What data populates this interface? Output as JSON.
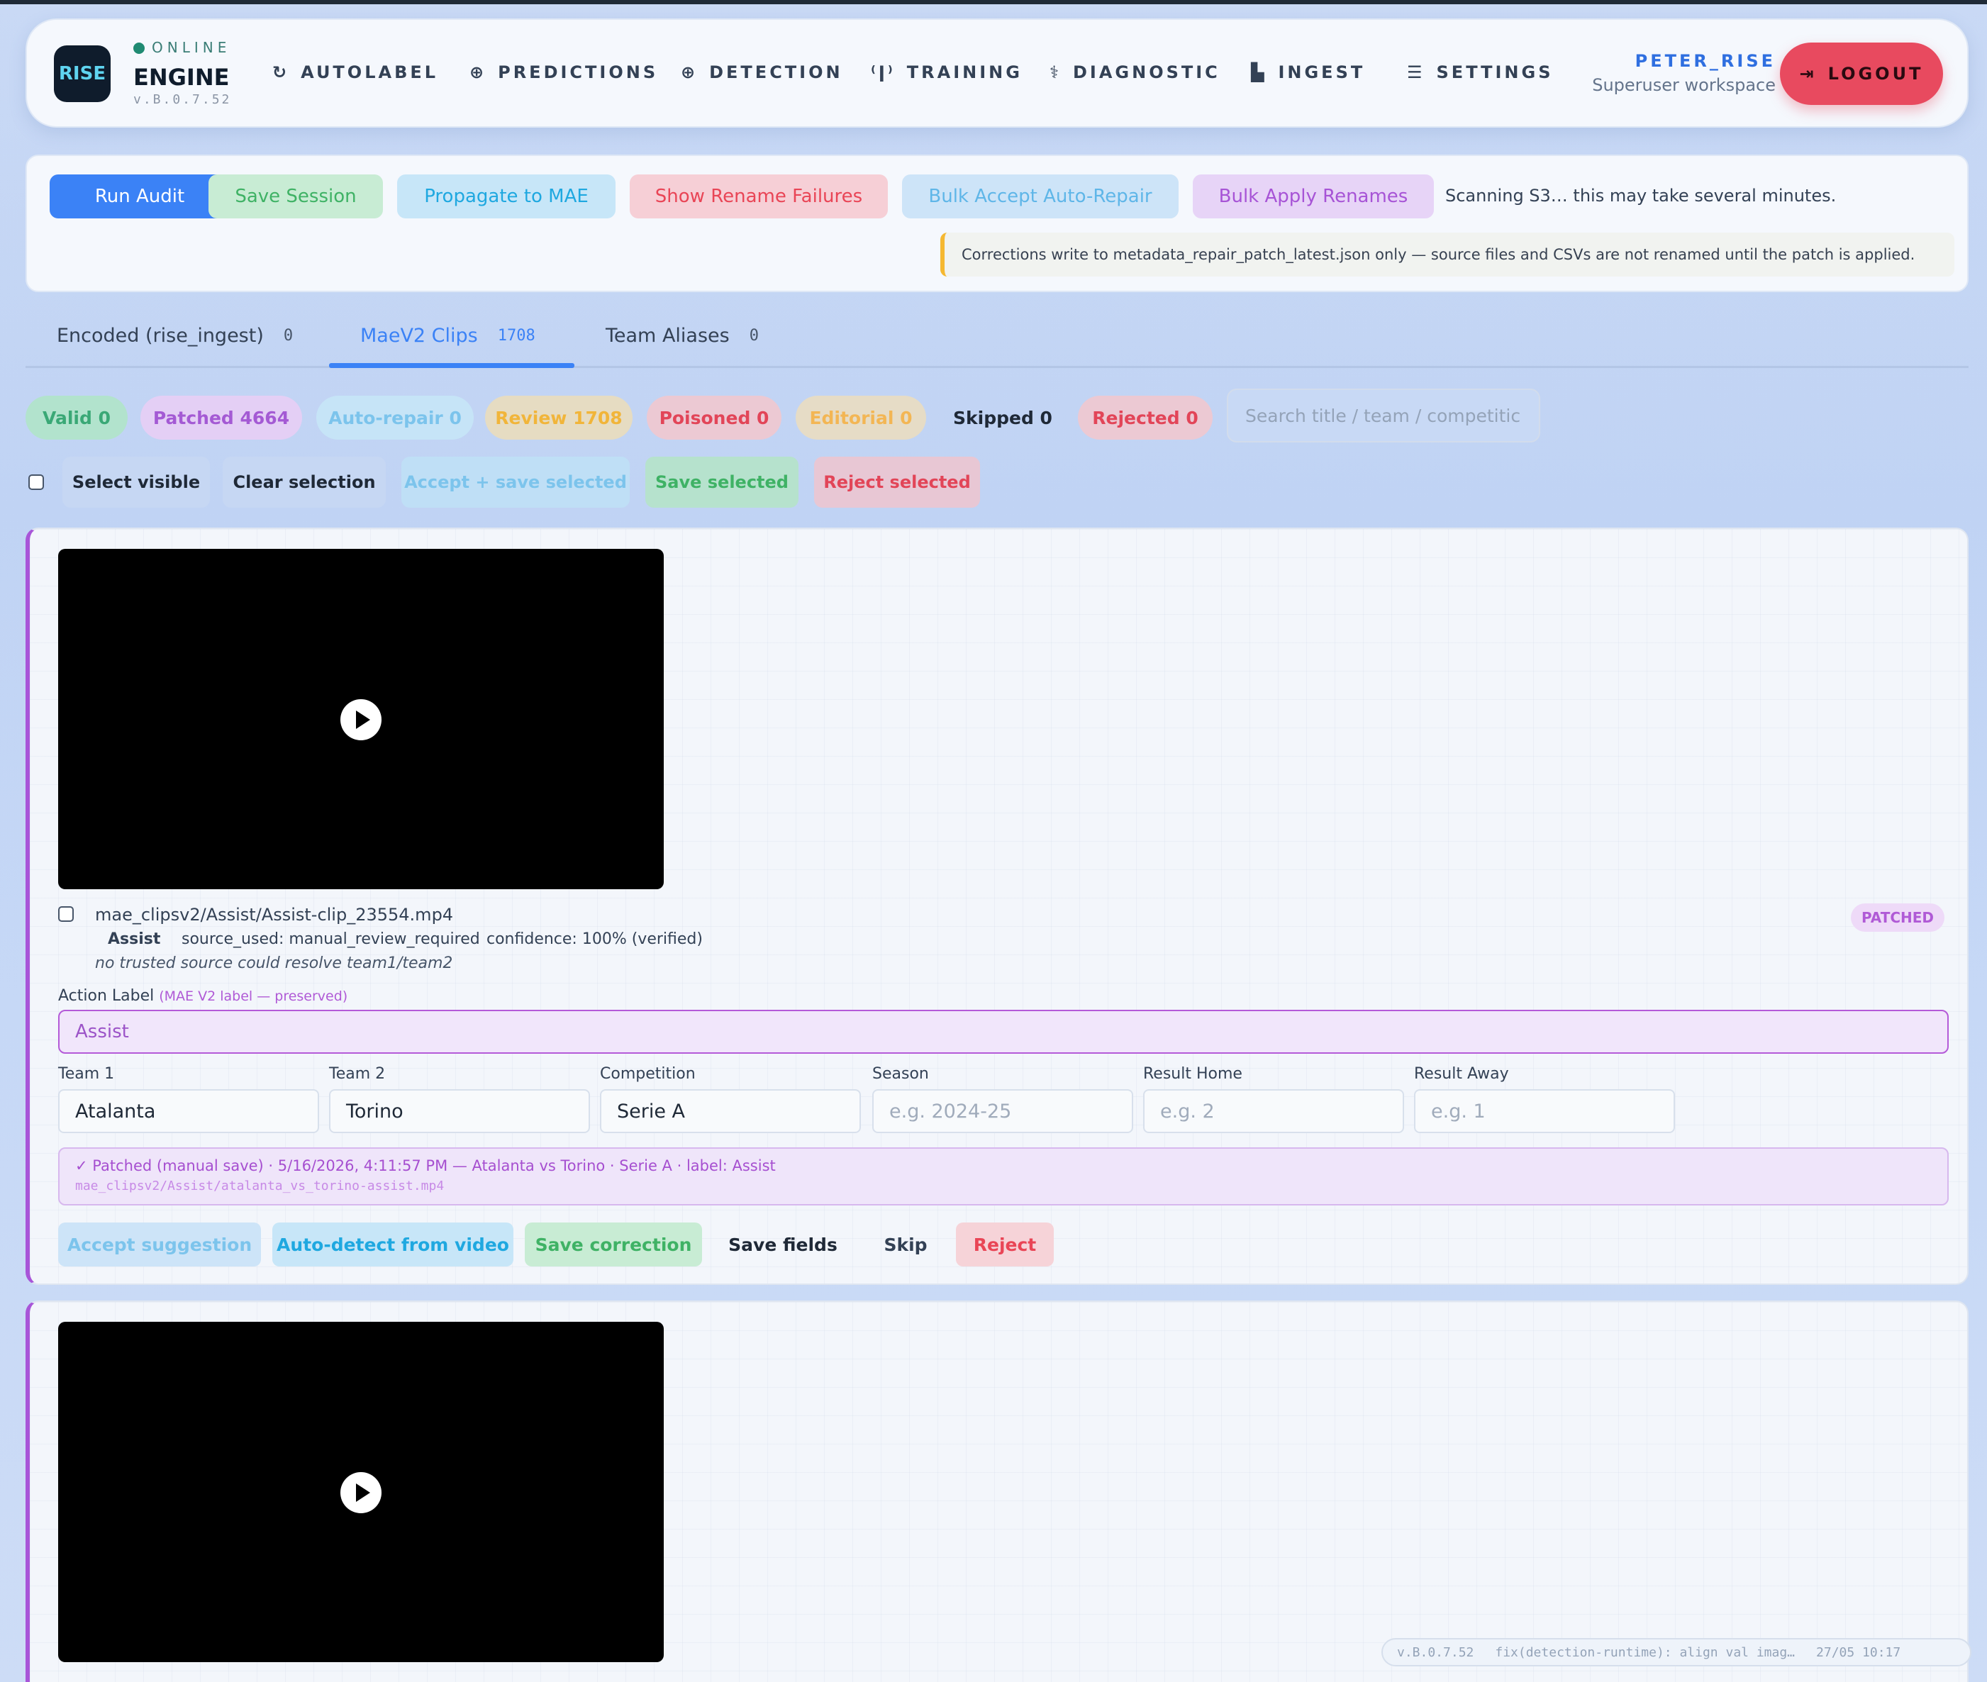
{
  "header": {
    "status": "ONLINE",
    "brand": "ENGINE",
    "version": "v.B.0.7.52",
    "logo_text": "RISE",
    "nav": [
      {
        "label": "AUTOLABEL",
        "icon": "autolabel-icon"
      },
      {
        "label": "PREDICTIONS",
        "icon": "predictions-icon"
      },
      {
        "label": "DETECTION",
        "icon": "detection-icon"
      },
      {
        "label": "TRAINING",
        "icon": "training-icon"
      },
      {
        "label": "DIAGNOSTIC",
        "icon": "diagnostic-icon"
      },
      {
        "label": "INGEST",
        "icon": "ingest-icon"
      },
      {
        "label": "SETTINGS",
        "icon": "settings-icon"
      }
    ],
    "user": "PETER_RISE",
    "workspace": "Superuser workspace",
    "logout": "LOGOUT"
  },
  "toolbar": {
    "run_audit": "Run Audit",
    "save_session": "Save Session",
    "propagate": "Propagate to MAE",
    "show_rename_failures": "Show Rename Failures",
    "bulk_accept": "Bulk Accept Auto-Repair",
    "bulk_apply": "Bulk Apply Renames",
    "scan_status": "Scanning S3… this may take several minutes.",
    "notice": "Corrections write to metadata_repair_patch_latest.json only — source files and CSVs are not renamed until the patch is applied."
  },
  "tabs": [
    {
      "label": "Encoded (rise_ingest)",
      "count": "0"
    },
    {
      "label": "MaeV2 Clips",
      "count": "1708"
    },
    {
      "label": "Team Aliases",
      "count": "0"
    }
  ],
  "filters": {
    "valid": "Valid 0",
    "patched": "Patched 4664",
    "auto_repair": "Auto-repair 0",
    "review": "Review 1708",
    "poisoned": "Poisoned 0",
    "editorial": "Editorial 0",
    "skipped": "Skipped 0",
    "rejected": "Rejected 0",
    "search_placeholder": "Search title / team / competitic"
  },
  "selection": {
    "select_visible": "Select visible",
    "clear": "Clear selection",
    "accept_save": "Accept + save selected",
    "save": "Save selected",
    "reject": "Reject selected"
  },
  "clip": {
    "filename": "mae_clipsv2/Assist/Assist-clip_23554.mp4",
    "tag": "Assist",
    "source": "source_used: manual_review_required",
    "confidence": "confidence: 100% (verified)",
    "note": "no trusted source could resolve team1/team2",
    "badge": "PATCHED",
    "action_label": "Action Label",
    "action_label_sub": "(MAE V2 label — preserved)",
    "action_value": "Assist",
    "fields": [
      {
        "label": "Team 1",
        "value": "Atalanta",
        "placeholder": ""
      },
      {
        "label": "Team 2",
        "value": "Torino",
        "placeholder": ""
      },
      {
        "label": "Competition",
        "value": "Serie A",
        "placeholder": ""
      },
      {
        "label": "Season",
        "value": "",
        "placeholder": "e.g. 2024-25"
      },
      {
        "label": "Result Home",
        "value": "",
        "placeholder": "e.g. 2"
      },
      {
        "label": "Result Away",
        "value": "",
        "placeholder": "e.g. 1"
      }
    ],
    "patched_line": "✓ Patched (manual save) · 5/16/2026, 4:11:57 PM — Atalanta vs Torino · Serie A · label: Assist",
    "patched_path": "mae_clipsv2/Assist/atalanta_vs_torino-assist.mp4",
    "actions": {
      "accept": "Accept suggestion",
      "autodetect": "Auto-detect from video",
      "save_correction": "Save correction",
      "save_fields": "Save fields",
      "skip": "Skip",
      "reject": "Reject"
    }
  },
  "footer": {
    "version": "v.B.0.7.52",
    "commit": "fix(detection-runtime): align val imag…",
    "time": "27/05 10:17"
  },
  "colors": {
    "accent": "#3b82f6",
    "patched": "#a855d8",
    "danger": "#e84a5f",
    "success": "#3fbf6a"
  }
}
